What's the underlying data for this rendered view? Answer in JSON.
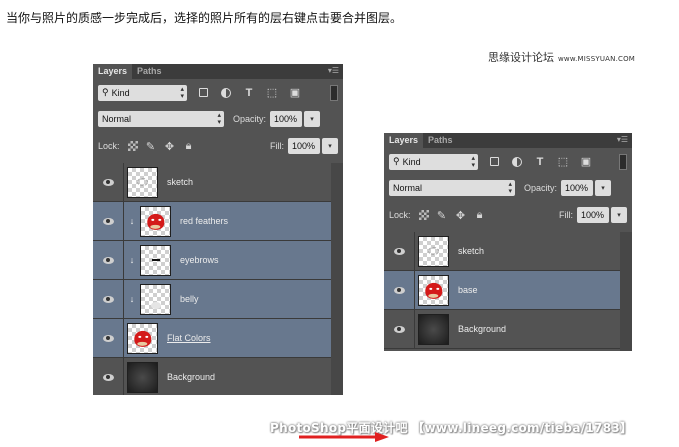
{
  "instruction": "当你与照片的质感一步完成后，选择的照片所有的层右键点击要合并图层。",
  "site_logo": {
    "cn": "思缘设计论坛",
    "en": "www.MISSYUAN.COM"
  },
  "watermark": "PhotoShop平面设计吧 【www.lineeg.com/tieba/1783】",
  "arrow_color": "#e02020",
  "panels": [
    {
      "tabs": [
        "Layers",
        "Paths"
      ],
      "kind_label": "Kind",
      "kind_icon": "search-icon",
      "filter_icons": [
        "image-filter-icon",
        "adjustment-filter-icon",
        "type-filter-icon",
        "shape-filter-icon",
        "smart-object-filter-icon"
      ],
      "blend_mode": "Normal",
      "opacity_label": "Opacity:",
      "opacity_value": "100%",
      "lock_label": "Lock:",
      "fill_label": "Fill:",
      "fill_value": "100%",
      "layers": [
        {
          "name": "sketch",
          "selected": false,
          "clipped": false,
          "thumb": "sketch"
        },
        {
          "name": "red feathers",
          "selected": true,
          "clipped": true,
          "thumb": "bird"
        },
        {
          "name": "eyebrows",
          "selected": true,
          "clipped": true,
          "thumb": "brow"
        },
        {
          "name": "belly",
          "selected": true,
          "clipped": true,
          "thumb": "belly"
        },
        {
          "name": "Flat Colors",
          "selected": true,
          "clipped": false,
          "thumb": "bird"
        },
        {
          "name": "Background",
          "selected": false,
          "clipped": false,
          "thumb": "dark"
        }
      ]
    },
    {
      "tabs": [
        "Layers",
        "Paths"
      ],
      "kind_label": "Kind",
      "kind_icon": "search-icon",
      "filter_icons": [
        "image-filter-icon",
        "adjustment-filter-icon",
        "type-filter-icon",
        "shape-filter-icon",
        "smart-object-filter-icon"
      ],
      "blend_mode": "Normal",
      "opacity_label": "Opacity:",
      "opacity_value": "100%",
      "lock_label": "Lock:",
      "fill_label": "Fill:",
      "fill_value": "100%",
      "layers": [
        {
          "name": "sketch",
          "selected": false,
          "clipped": false,
          "thumb": "sketch"
        },
        {
          "name": "base",
          "selected": true,
          "clipped": false,
          "thumb": "bird"
        },
        {
          "name": "Background",
          "selected": false,
          "clipped": false,
          "thumb": "dark"
        }
      ]
    }
  ]
}
